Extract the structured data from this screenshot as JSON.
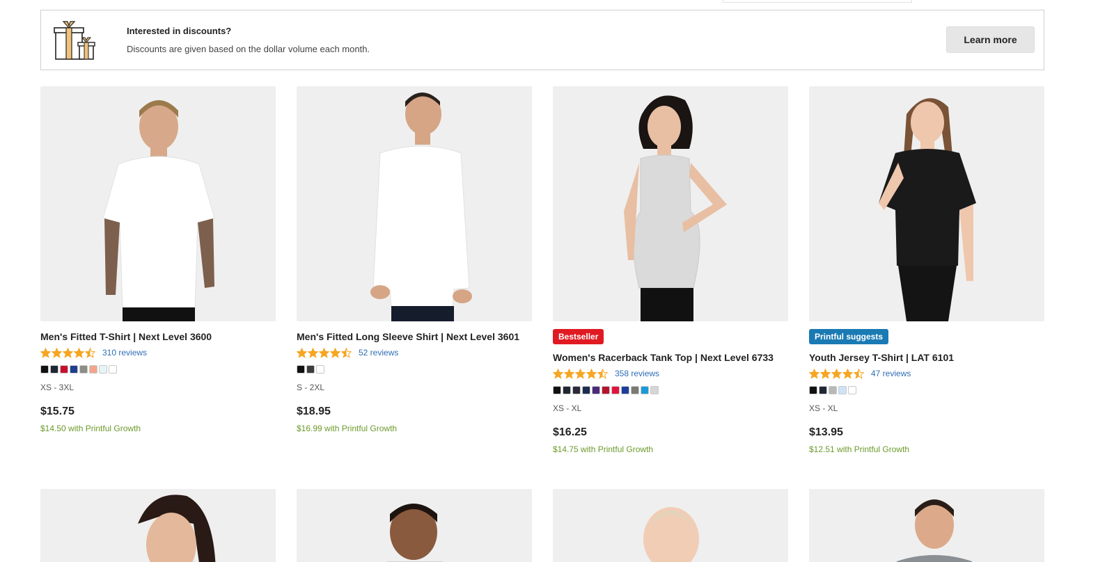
{
  "banner": {
    "title": "Interested in discounts?",
    "subtitle": "Discounts are given based on the dollar volume each month.",
    "button": "Learn more",
    "icon": "gift-icon"
  },
  "products": [
    {
      "name": "Men's Fitted T-Shirt | Next Level 3600",
      "badge": "",
      "rating": 4.5,
      "reviews": "310 reviews",
      "colors": [
        "#111111",
        "#1f2733",
        "#c8102e",
        "#1d3f8f",
        "#8d8d87",
        "#f4a58a",
        "#e6f4f6",
        "#ffffff"
      ],
      "sizes": "XS - 3XL",
      "price": "$15.75",
      "growth": "$14.50 with Printful Growth",
      "shirt_color": "#ffffff"
    },
    {
      "name": "Men's Fitted Long Sleeve Shirt | Next Level 3601",
      "badge": "",
      "rating": 4.5,
      "reviews": "52 reviews",
      "colors": [
        "#111111",
        "#3d3d3d",
        "#ffffff"
      ],
      "sizes": "S - 2XL",
      "price": "$18.95",
      "growth": "$16.99 with Printful Growth",
      "shirt_color": "#ffffff"
    },
    {
      "name": "Women's Racerback Tank Top | Next Level 6733",
      "badge": "Bestseller",
      "badge_color": "red",
      "rating": 4.5,
      "reviews": "358 reviews",
      "colors": [
        "#111111",
        "#1f2733",
        "#2a2a3a",
        "#1d2d4f",
        "#4b2a7a",
        "#b5142d",
        "#e2143c",
        "#1d3f9b",
        "#7a7a72",
        "#1a9ad6",
        "#d6d6d6"
      ],
      "sizes": "XS - XL",
      "price": "$16.25",
      "growth": "$14.75 with Printful Growth",
      "shirt_color": "#d9d9d9"
    },
    {
      "name": "Youth Jersey T-Shirt | LAT 6101",
      "badge": "Printful suggests",
      "badge_color": "blue",
      "rating": 4.5,
      "reviews": "47 reviews",
      "colors": [
        "#111111",
        "#1f2733",
        "#b8b8b8",
        "#cfe3f7",
        "#ffffff"
      ],
      "sizes": "XS - XL",
      "price": "$13.95",
      "growth": "$12.51 with Printful Growth",
      "shirt_color": "#1a1a1a"
    }
  ]
}
